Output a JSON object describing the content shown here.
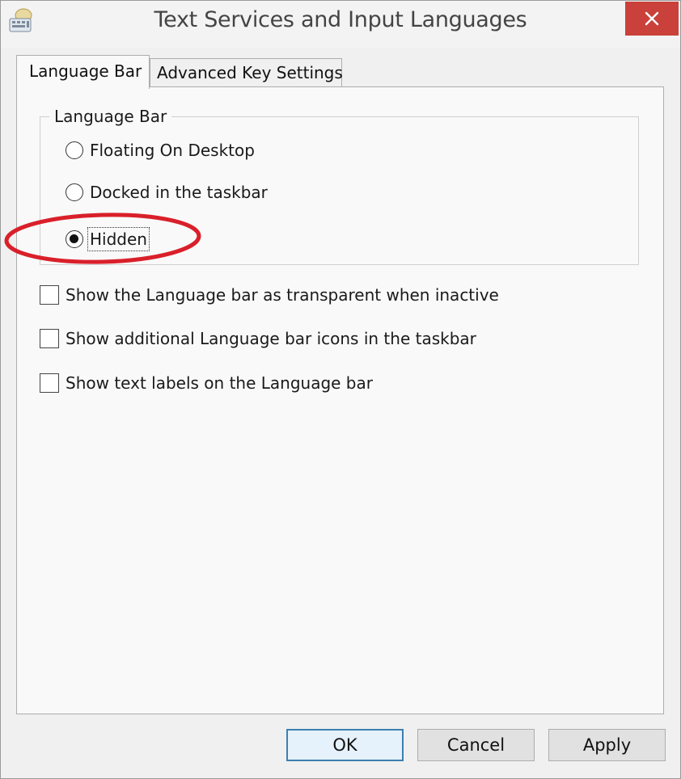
{
  "window": {
    "title": "Text Services and Input Languages",
    "app_icon": "keyboard-globe-icon",
    "close_icon": "close-x-icon",
    "close_color": "#c9413a"
  },
  "tabs": [
    {
      "label": "Language Bar",
      "active": true
    },
    {
      "label": "Advanced Key Settings",
      "active": false
    }
  ],
  "language_bar_group": {
    "legend": "Language Bar",
    "options": [
      {
        "label": "Floating On Desktop",
        "selected": false
      },
      {
        "label": "Docked in the taskbar",
        "selected": false
      },
      {
        "label": "Hidden",
        "selected": true
      }
    ]
  },
  "checkboxes": [
    {
      "label": "Show the Language bar as transparent when inactive",
      "checked": false
    },
    {
      "label": "Show additional Language bar icons in the taskbar",
      "checked": false
    },
    {
      "label": "Show text labels on the Language bar",
      "checked": false
    }
  ],
  "buttons": {
    "ok": "OK",
    "cancel": "Cancel",
    "apply": "Apply"
  },
  "annotation": {
    "shape": "ellipse",
    "color": "#d9202a",
    "target": "Hidden"
  }
}
